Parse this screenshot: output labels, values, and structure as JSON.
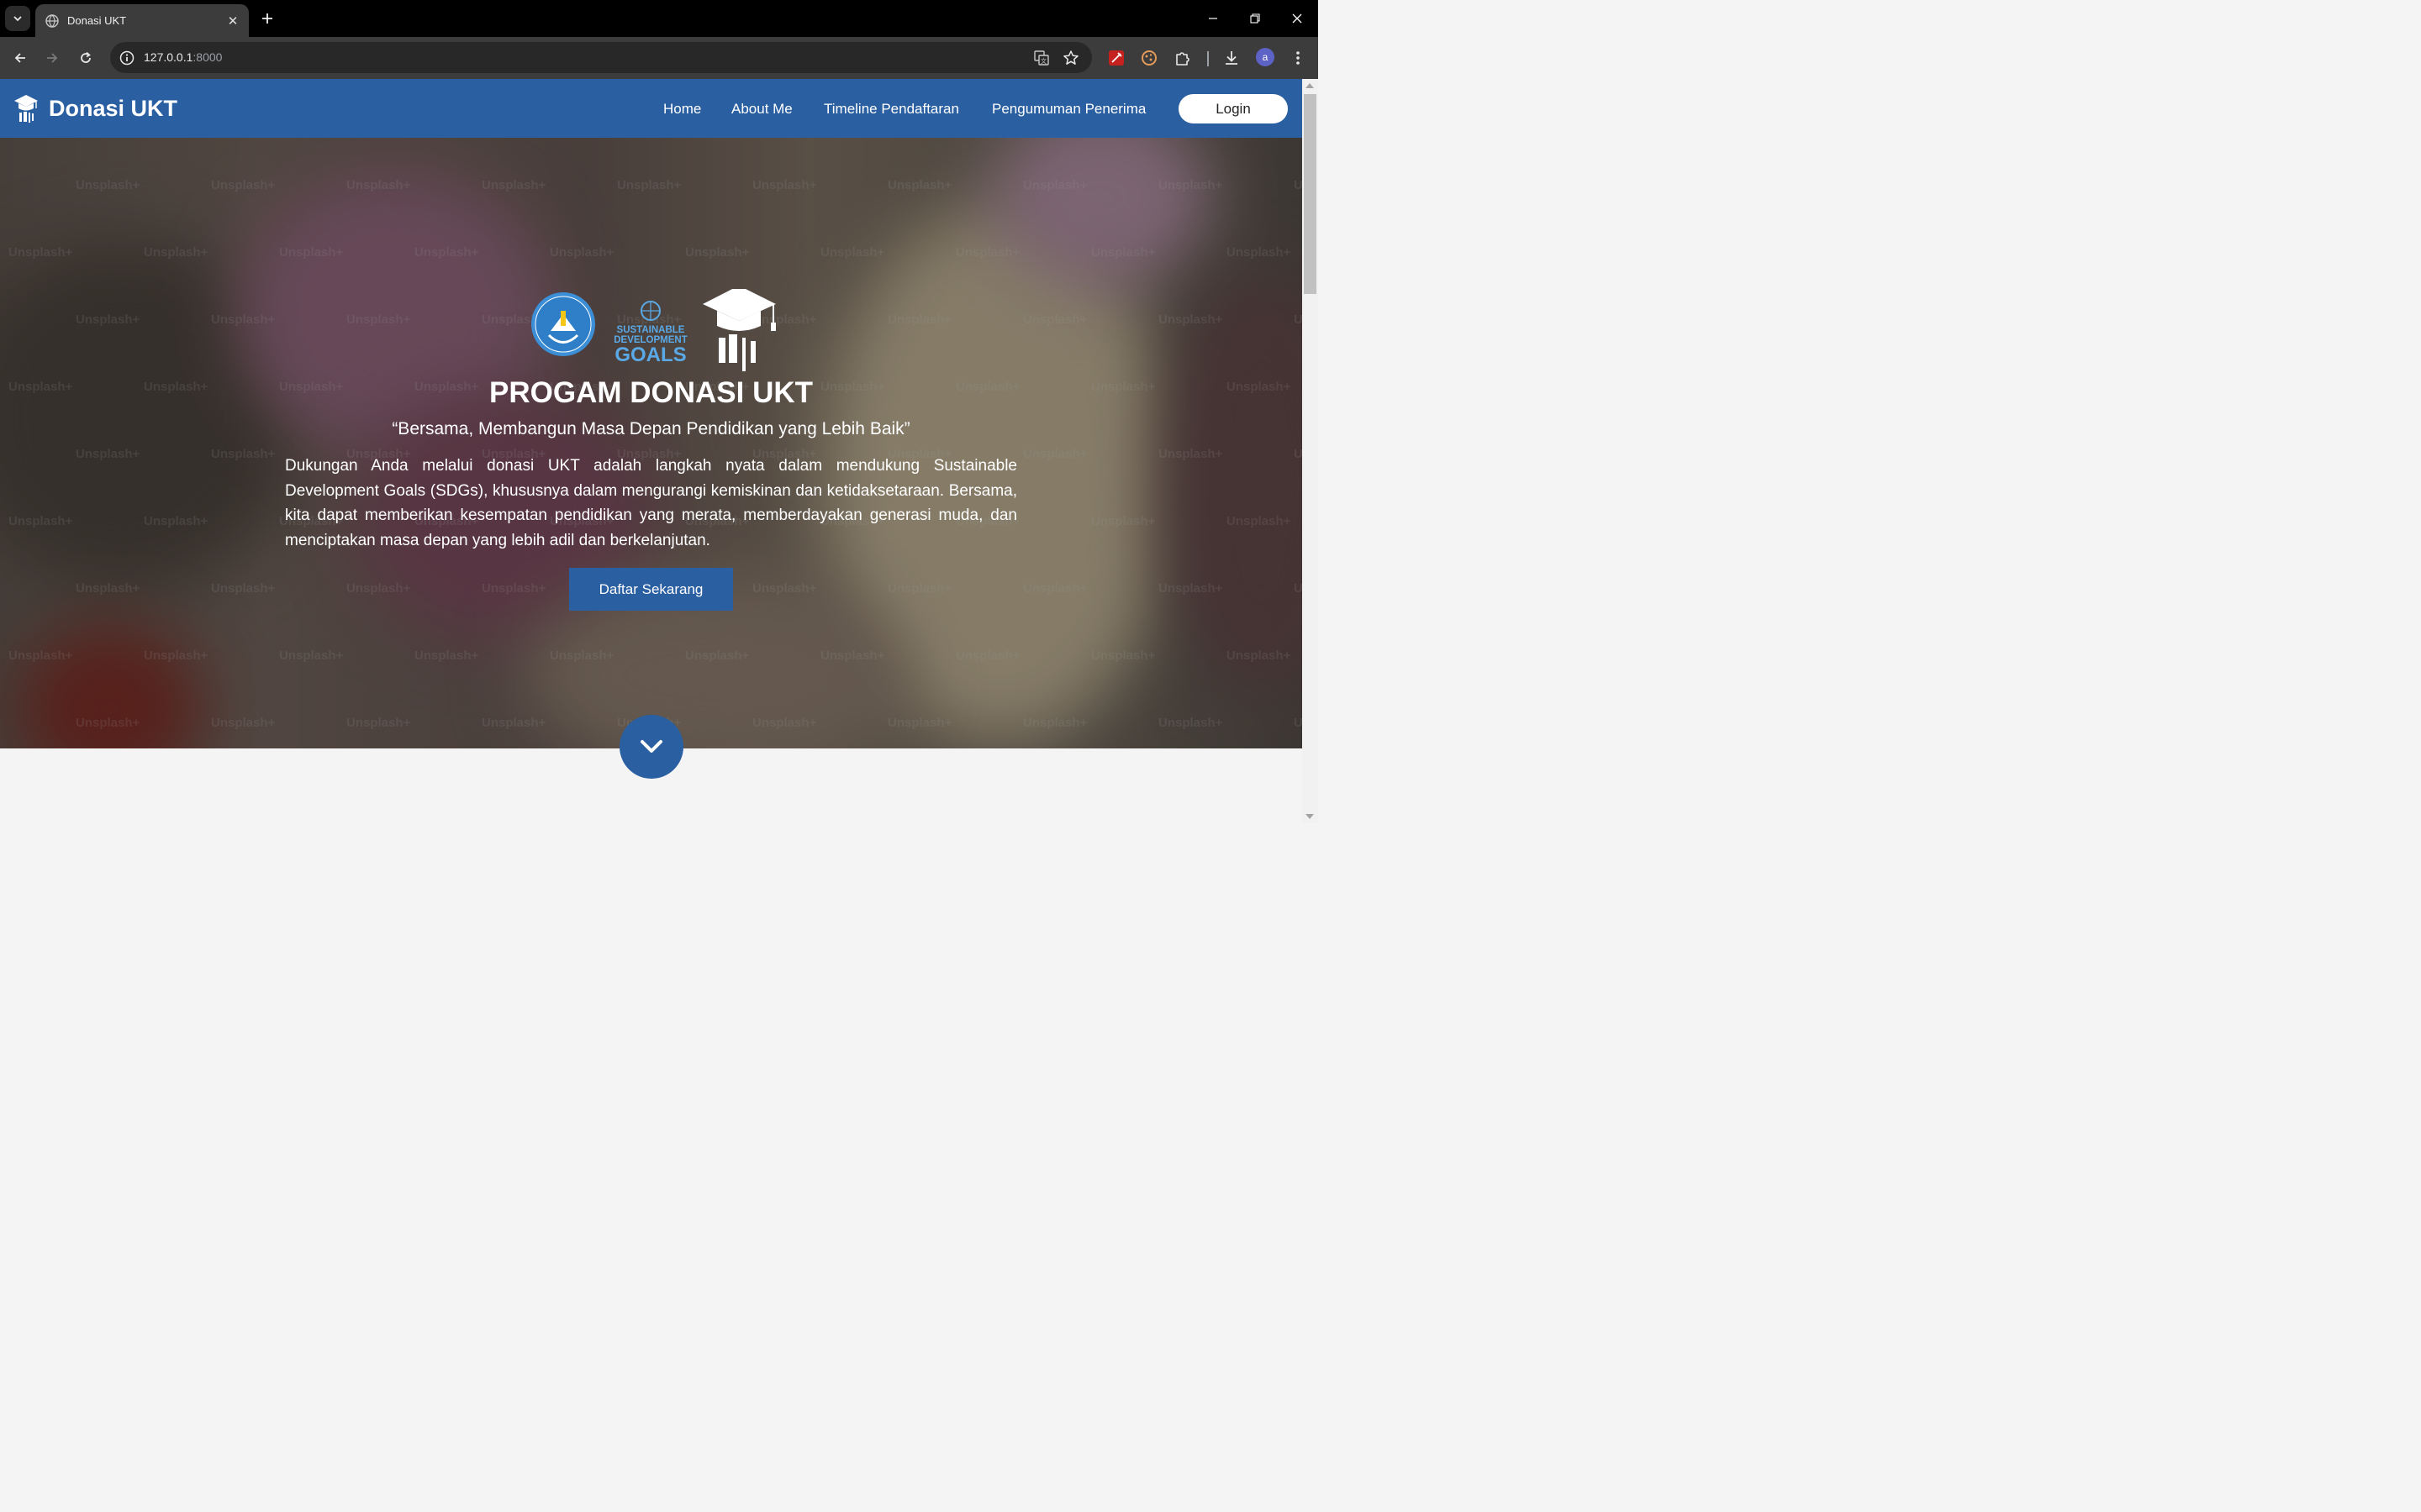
{
  "browser": {
    "tab_title": "Donasi UKT",
    "url_host": "127.0.0.1",
    "url_port": ":8000",
    "profile_initial": "a"
  },
  "site": {
    "brand": "Donasi UKT",
    "nav": {
      "home": "Home",
      "about": "About Me",
      "timeline": "Timeline Pendaftaran",
      "announcement": "Pengumuman Penerima",
      "login": "Login"
    }
  },
  "hero": {
    "logos": {
      "tut_wuri": "TUT WURI HANDAYANI",
      "sdg_line1": "SUSTAINABLE",
      "sdg_line2": "DEVELOPMENT",
      "sdg_line3": "GOALS"
    },
    "title": "PROGAM DONASI UKT",
    "quote": "“Bersama, Membangun Masa Depan Pendidikan yang Lebih Baik”",
    "description": "Dukungan Anda melalui donasi UKT adalah langkah nyata dalam mendukung Sustainable Development Goals (SDGs), khususnya dalam mengurangi kemiskinan dan ketidaksetaraan. Bersama, kita dapat memberikan kesempatan pendidikan yang merata, memberdayakan generasi muda, dan menciptakan masa depan yang lebih adil dan berkelanjutan.",
    "cta": "Daftar Sekarang",
    "watermark": "Unsplash+"
  },
  "colors": {
    "brand_blue": "#2a5fa1",
    "chrome_dark": "#3c3c3c"
  }
}
